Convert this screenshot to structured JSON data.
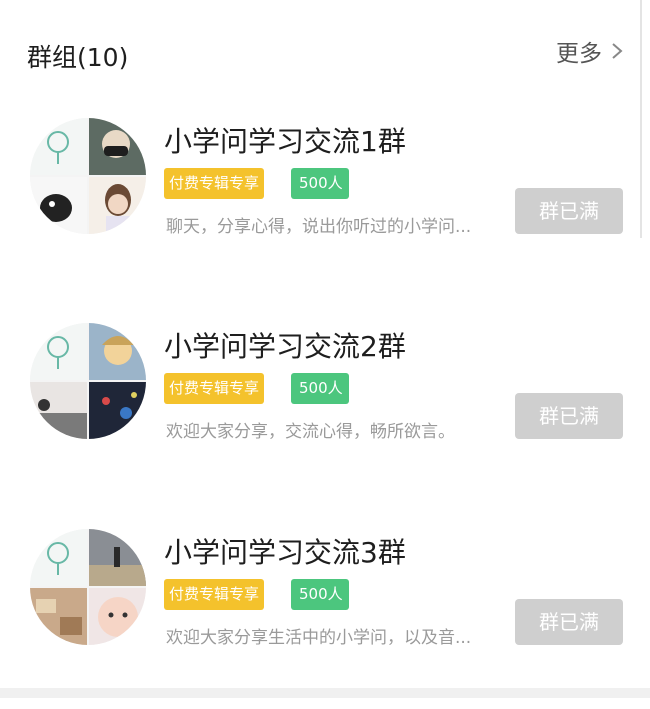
{
  "header": {
    "title": "群组(10)",
    "more_label": "更多"
  },
  "groups": [
    {
      "name": "小学问学习交流1群",
      "badge_paid": "付费专辑专享",
      "badge_count": "500人",
      "description": "聊天，分享心得，说出你听过的小学问...",
      "button_label": "群已满"
    },
    {
      "name": "小学问学习交流2群",
      "badge_paid": "付费专辑专享",
      "badge_count": "500人",
      "description": "欢迎大家分享，交流心得，畅所欲言。",
      "button_label": "群已满"
    },
    {
      "name": "小学问学习交流3群",
      "badge_paid": "付费专辑专享",
      "badge_count": "500人",
      "description": "欢迎大家分享生活中的小学问，以及音...",
      "button_label": "群已满"
    }
  ],
  "colors": {
    "paid_badge": "#f4c22c",
    "count_badge": "#4cc67e",
    "full_button": "#cfcfcf"
  },
  "icons": [
    "chevron-right-icon",
    "group-avatar-collage"
  ]
}
